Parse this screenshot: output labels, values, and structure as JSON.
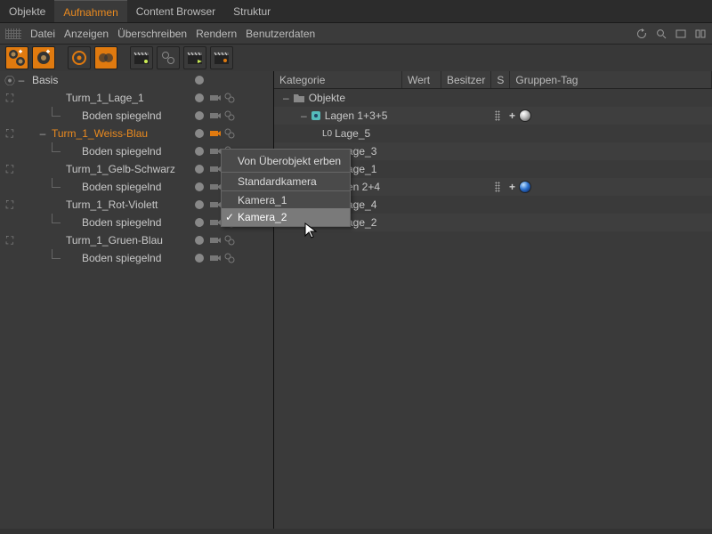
{
  "tabs": [
    "Objekte",
    "Aufnahmen",
    "Content Browser",
    "Struktur"
  ],
  "active_tab": 1,
  "menu": [
    "Datei",
    "Anzeigen",
    "Überschreiben",
    "Rendern",
    "Benutzerdaten"
  ],
  "left": {
    "root": "Basis",
    "items": [
      {
        "label": "Turm_1_Lage_1",
        "children": [
          "Boden spiegelnd"
        ],
        "sel": false
      },
      {
        "label": "Turm_1_Weiss-Blau",
        "children": [
          "Boden spiegelnd"
        ],
        "sel": true
      },
      {
        "label": "Turm_1_Gelb-Schwarz",
        "children": [
          "Boden spiegelnd"
        ],
        "sel": false
      },
      {
        "label": "Turm_1_Rot-Violett",
        "children": [
          "Boden spiegelnd"
        ],
        "sel": false
      },
      {
        "label": "Turm_1_Gruen-Blau",
        "children": [
          "Boden spiegelnd"
        ],
        "sel": false
      }
    ]
  },
  "right": {
    "headers": {
      "cat": "Kategorie",
      "val": "Wert",
      "own": "Besitzer",
      "s": "S",
      "tag": "Gruppen-Tag"
    },
    "rows": [
      {
        "label": "Objekte",
        "type": "folder",
        "indent": 0
      },
      {
        "label": "Lagen 1+3+5",
        "type": "layer",
        "indent": 1,
        "s": true,
        "tag": "sphere-white"
      },
      {
        "label": "Lage_5",
        "type": "L0",
        "indent": 2
      },
      {
        "label": "age_3",
        "indent": 2,
        "trunc": true
      },
      {
        "label": "age_1",
        "indent": 2,
        "trunc": true
      },
      {
        "label": "en 2+4",
        "indent": 1,
        "trunc": true,
        "s": true,
        "tag": "sphere-blue"
      },
      {
        "label": "age_4",
        "indent": 2,
        "trunc": true
      },
      {
        "label": "age_2",
        "indent": 2,
        "trunc": true
      }
    ]
  },
  "ctx": {
    "items": [
      {
        "label": "Von Überobjekt erben",
        "sep_below": true
      },
      {
        "label": "Standardkamera"
      },
      {
        "label": "Kamera_1",
        "sep_above": true
      },
      {
        "label": "Kamera_2",
        "checked": true,
        "hl": true
      }
    ]
  }
}
